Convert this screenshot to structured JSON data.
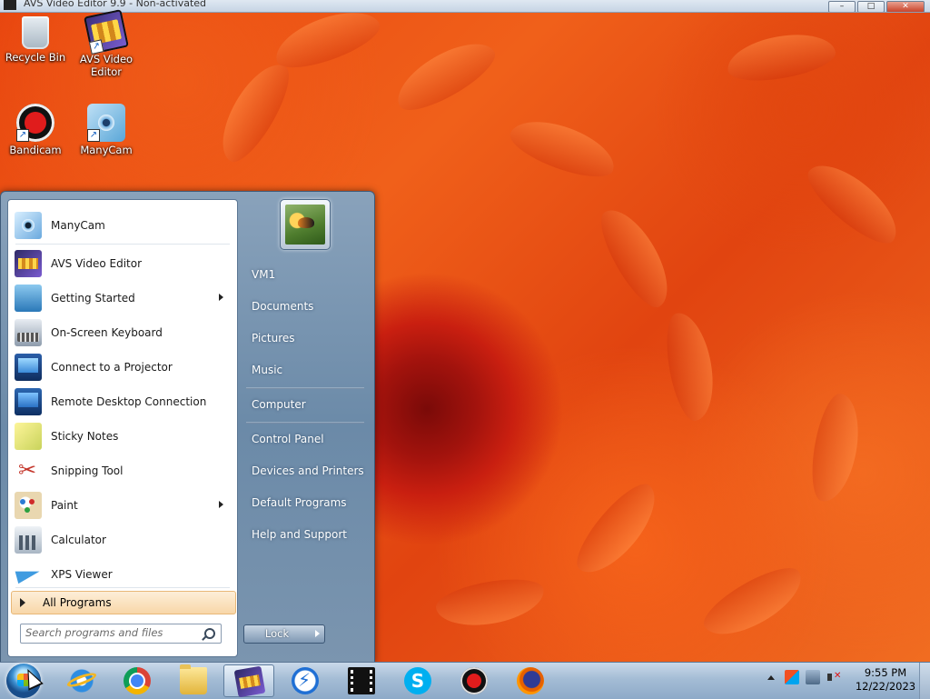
{
  "window": {
    "title": "AVS Video Editor 9.9 - Non-activated"
  },
  "desktop_icons": [
    {
      "label": "Recycle Bin",
      "icon": "recycle-bin-icon"
    },
    {
      "label": "AVS Video Editor",
      "icon": "avs-video-editor-icon"
    },
    {
      "label": "Bandicam",
      "icon": "bandicam-icon"
    },
    {
      "label": "ManyCam",
      "icon": "manycam-icon"
    }
  ],
  "start_menu": {
    "programs": [
      {
        "label": "ManyCam",
        "icon": "manycam-icon",
        "submenu": false
      },
      {
        "label": "AVS Video Editor",
        "icon": "avs-video-editor-icon",
        "submenu": false
      },
      {
        "label": "Getting Started",
        "icon": "getting-started-icon",
        "submenu": true
      },
      {
        "label": "On-Screen Keyboard",
        "icon": "keyboard-icon",
        "submenu": false
      },
      {
        "label": "Connect to a Projector",
        "icon": "projector-icon",
        "submenu": false
      },
      {
        "label": "Remote Desktop Connection",
        "icon": "remote-desktop-icon",
        "submenu": false
      },
      {
        "label": "Sticky Notes",
        "icon": "sticky-notes-icon",
        "submenu": false
      },
      {
        "label": "Snipping Tool",
        "icon": "scissors-icon",
        "submenu": false
      },
      {
        "label": "Paint",
        "icon": "paint-palette-icon",
        "submenu": true
      },
      {
        "label": "Calculator",
        "icon": "calculator-icon",
        "submenu": false
      },
      {
        "label": "XPS Viewer",
        "icon": "xps-viewer-icon",
        "submenu": false
      }
    ],
    "all_programs_label": "All Programs",
    "search_placeholder": "Search programs and files",
    "right_items": [
      {
        "label": "VM1"
      },
      {
        "label": "Documents"
      },
      {
        "label": "Pictures"
      },
      {
        "label": "Music"
      },
      {
        "label": "Computer"
      },
      {
        "label": "Control Panel"
      },
      {
        "label": "Devices and Printers"
      },
      {
        "label": "Default Programs"
      },
      {
        "label": "Help and Support"
      }
    ],
    "lock_label": "Lock"
  },
  "taskbar": {
    "pinned": [
      {
        "icon": "internet-explorer-icon"
      },
      {
        "icon": "chrome-icon"
      },
      {
        "icon": "file-explorer-icon"
      },
      {
        "icon": "avs-video-editor-icon",
        "active": true
      },
      {
        "icon": "thunder-icon"
      },
      {
        "icon": "film-strip-icon"
      },
      {
        "icon": "skype-icon"
      },
      {
        "icon": "bandicam-icon"
      },
      {
        "icon": "firefox-icon"
      }
    ],
    "clock": {
      "time": "9:55 PM",
      "date": "12/22/2023"
    }
  },
  "colors": {
    "start_menu_highlight": "#f8d7a8",
    "taskbar": "#a4bcd5"
  }
}
